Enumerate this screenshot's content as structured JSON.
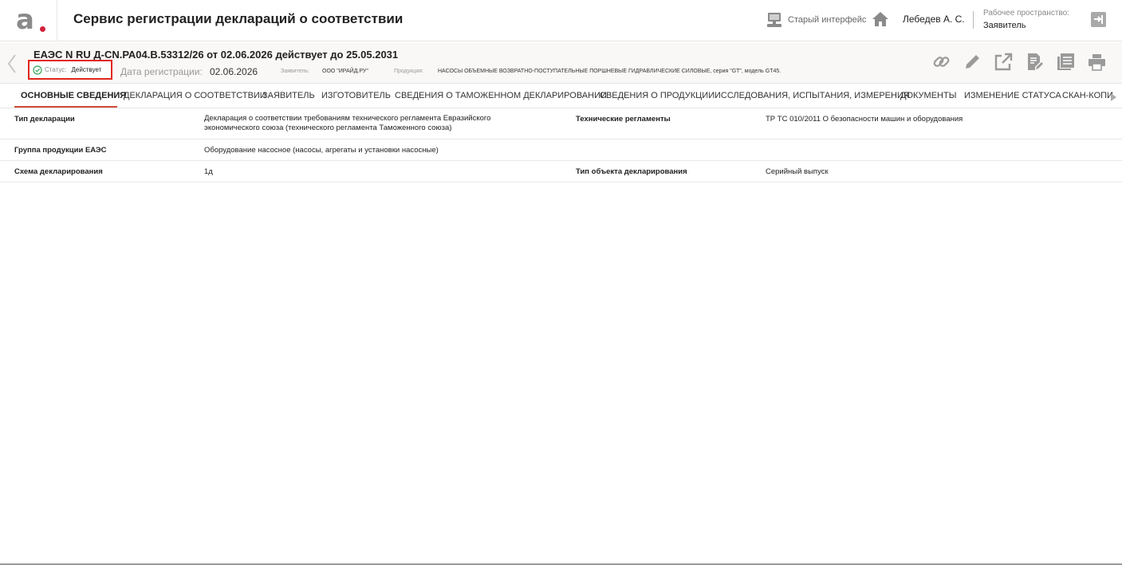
{
  "app": {
    "title": "Сервис регистрации деклараций о соответствии",
    "logo_icon": "alta-logo-icon"
  },
  "topbar": {
    "old_interface_label": "Старый интерфейс",
    "user_name": "Лебедев А. С.",
    "workspace_label": "Рабочее пространство:",
    "workspace_value": "Заявитель"
  },
  "declaration": {
    "title": "ЕАЭС N RU Д-CN.РА04.В.53312/26 от 02.06.2026 действует до 25.05.2031",
    "status_label": "Статус:",
    "status_value": "Действует",
    "reg_date_label": "Дата регистрации:",
    "reg_date_value": "02.06.2026",
    "applicant_label": "Заявитель:",
    "applicant_value": "ООО \"ИРАЙД.РУ\"",
    "product_label": "Продукция:",
    "product_value": "НАСОСЫ ОБЪЕМНЫЕ ВОЗВРАТНО-ПОСТУПАТЕЛЬНЫЕ ПОРШНЕВЫЕ ГИДРАВЛИЧЕСКИЕ СИЛОВЫЕ, серия \"GT\", модель GT45."
  },
  "actions": [
    "link-icon",
    "edit-icon",
    "export-icon",
    "document-edit-icon",
    "list-icon",
    "print-icon"
  ],
  "tabs": [
    {
      "label": "ОСНОВНЫЕ СВЕДЕНИЯ",
      "active": true
    },
    {
      "label": "ДЕКЛАРАЦИЯ О СООТВЕТСТВИИ"
    },
    {
      "label": "ЗАЯВИТЕЛЬ"
    },
    {
      "label": "ИЗГОТОВИТЕЛЬ"
    },
    {
      "label": "СВЕДЕНИЯ О ТАМОЖЕННОМ ДЕКЛАРИРОВАНИИ"
    },
    {
      "label": "СВЕДЕНИЯ О ПРОДУКЦИИ"
    },
    {
      "label": "ИССЛЕДОВАНИЯ, ИСПЫТАНИЯ, ИЗМЕРЕНИЯ"
    },
    {
      "label": "ДОКУМЕНТЫ"
    },
    {
      "label": "ИЗМЕНЕНИЕ СТАТУСА"
    },
    {
      "label": "СКАН-КОПИ"
    }
  ],
  "fields": {
    "decl_type_label": "Тип декларации",
    "decl_type_value_line1": "Декларация о соответствии требованиям технического регламента Евразийского",
    "decl_type_value_line2": "экономического союза (технического регламента Таможенного союза)",
    "tech_reg_label": "Технические регламенты",
    "tech_reg_value": "ТР ТС 010/2011 О безопасности машин и оборудования",
    "product_group_label": "Группа продукции ЕАЭС",
    "product_group_value": "Оборудование насосное (насосы, агрегаты и установки насосные)",
    "scheme_label": "Схема декларирования",
    "scheme_value": "1д",
    "object_type_label": "Тип объекта декларирования",
    "object_type_value": "Серийный выпуск"
  }
}
